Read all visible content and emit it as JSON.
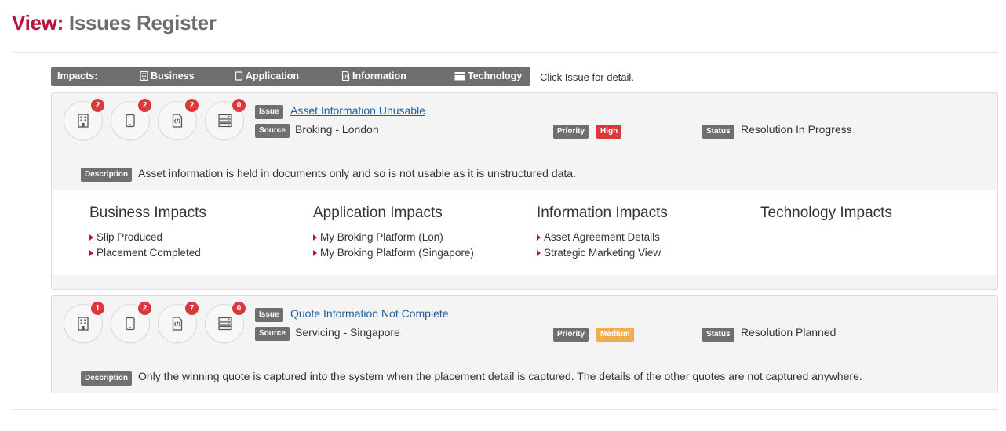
{
  "header": {
    "prefix": "View:",
    "title": "Issues Register"
  },
  "legend": {
    "label": "Impacts:",
    "items": [
      {
        "label": "Business",
        "icon": "building-icon"
      },
      {
        "label": "Application",
        "icon": "tablet-icon"
      },
      {
        "label": "Information",
        "icon": "document-code-icon"
      },
      {
        "label": "Technology",
        "icon": "server-icon"
      }
    ],
    "hint": "Click Issue for detail."
  },
  "labels": {
    "issue": "Issue",
    "source": "Source",
    "priority": "Priority",
    "status": "Status",
    "description": "Description"
  },
  "issues": [
    {
      "counts": {
        "business": "2",
        "application": "2",
        "information": "2",
        "technology": "0"
      },
      "name": "Asset Information Unusable",
      "source": "Broking - London",
      "priority": "High",
      "status": "Resolution In Progress",
      "description": "Asset information is held in documents only and so is not usable as it is unstructured data.",
      "expanded": true,
      "impacts": {
        "business": {
          "title": "Business Impacts",
          "items": [
            "Slip Produced",
            "Placement Completed"
          ]
        },
        "application": {
          "title": "Application Impacts",
          "items": [
            "My Broking Platform (Lon)",
            "My Broking Platform (Singapore)"
          ]
        },
        "information": {
          "title": "Information Impacts",
          "items": [
            "Asset Agreement Details",
            "Strategic Marketing View"
          ]
        },
        "technology": {
          "title": "Technology Impacts",
          "items": []
        }
      }
    },
    {
      "counts": {
        "business": "1",
        "application": "2",
        "information": "7",
        "technology": "0"
      },
      "name": "Quote Information Not Complete",
      "source": "Servicing - Singapore",
      "priority": "Medium",
      "status": "Resolution Planned",
      "description": "Only the winning quote is captured into the system when the placement detail is captured. The details of the other quotes are not captured anywhere.",
      "expanded": false
    }
  ],
  "colors": {
    "accent": "#b5153b",
    "link": "#1f5f9c",
    "high": "#d9393c",
    "medium": "#f0ad4e",
    "label": "#6f6f6f"
  }
}
